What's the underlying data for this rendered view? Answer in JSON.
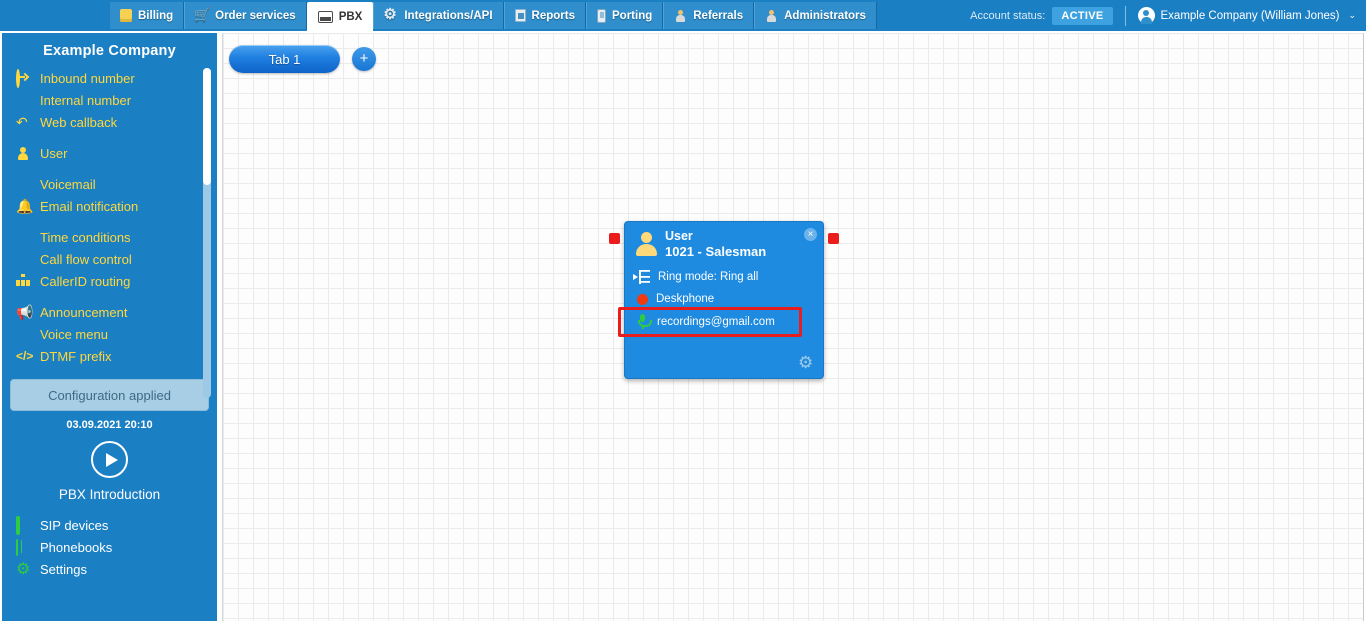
{
  "topnav": {
    "tabs": [
      {
        "label": "Billing",
        "icon": "wallet-icon",
        "active": false
      },
      {
        "label": "Order services",
        "icon": "cart-icon",
        "active": false
      },
      {
        "label": "PBX",
        "icon": "pbx-icon",
        "active": true
      },
      {
        "label": "Integrations/API",
        "icon": "gear-icon",
        "active": false
      },
      {
        "label": "Reports",
        "icon": "report-icon",
        "active": false
      },
      {
        "label": "Porting",
        "icon": "mobile-phone-icon",
        "active": false
      },
      {
        "label": "Referrals",
        "icon": "person-icon",
        "active": false
      },
      {
        "label": "Administrators",
        "icon": "person-icon",
        "active": false
      }
    ],
    "account_status_label": "Account status:",
    "account_status_value": "ACTIVE",
    "account_user": "Example Company (William Jones)",
    "caret": "⌄"
  },
  "sidebar": {
    "title": "Example Company",
    "items": [
      {
        "label": "Inbound number",
        "icon": "inbound-arrow-icon",
        "color": "#ffd83d"
      },
      {
        "label": "Internal number",
        "icon": "map-pin-icon",
        "color": "#ffd83d"
      },
      {
        "label": "Web callback",
        "icon": "callback-arrow-icon",
        "color": "#ffd83d"
      },
      {
        "label": "User",
        "icon": "user-icon",
        "color": "#ffd83d"
      },
      {
        "label": "Voicemail",
        "icon": "envelope-icon",
        "color": "#ffd83d"
      },
      {
        "label": "Email notification",
        "icon": "bell-icon",
        "color": "#ffd83d"
      },
      {
        "label": "Time conditions",
        "icon": "clock-icon",
        "color": "#ffd83d"
      },
      {
        "label": "Call flow control",
        "icon": "toggle-icon",
        "color": "#ffd83d"
      },
      {
        "label": "CallerID routing",
        "icon": "sitemap-icon",
        "color": "#ffd83d"
      },
      {
        "label": "Announcement",
        "icon": "megaphone-icon",
        "color": "#ffd83d"
      },
      {
        "label": "Voice menu",
        "icon": "grid-icon",
        "color": "#ffd83d"
      },
      {
        "label": "DTMF prefix",
        "icon": "code-icon",
        "color": "#ffd83d"
      }
    ],
    "status_button": "Configuration applied",
    "status_date": "03.09.2021 20:10",
    "intro_caption": "PBX Introduction",
    "play_icon": "play-icon",
    "bottom_items": [
      {
        "label": "SIP devices",
        "icon": "monitor-icon",
        "color": "#2ecc40"
      },
      {
        "label": "Phonebooks",
        "icon": "book-icon",
        "color": "#2ecc40"
      },
      {
        "label": "Settings",
        "icon": "gear-icon",
        "color": "#2ecc40"
      }
    ]
  },
  "canvas": {
    "flow_tab": "Tab 1",
    "add_tab_label": "+",
    "grid_size_px": 15
  },
  "node": {
    "type_label": "User",
    "name_label": "1021 - Salesman",
    "close_icon": "×",
    "rows": [
      {
        "text": "Ring mode: Ring all",
        "icon": "ring-mode-icon"
      },
      {
        "text": "Deskphone",
        "icon": "status-dot-icon"
      },
      {
        "text": "recordings@gmail.com",
        "icon": "microphone-icon",
        "highlighted": true
      }
    ],
    "gear_icon": "⚙",
    "port_color": "#ea1c1c",
    "highlight_color": "#e81d1d",
    "body_color": "#1e8ae0"
  }
}
